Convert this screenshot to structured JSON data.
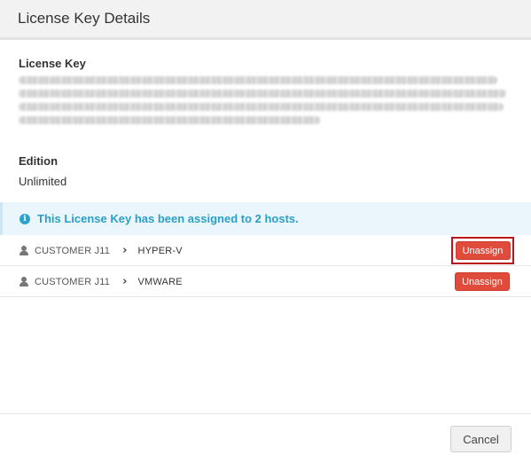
{
  "modal": {
    "title": "License Key Details"
  },
  "license_key": {
    "label": "License Key"
  },
  "edition": {
    "label": "Edition",
    "value": "Unlimited"
  },
  "alert": {
    "icon": "info-icon",
    "text": "This License Key has been assigned to 2 hosts.",
    "color": "#2a9fc9"
  },
  "hosts": [
    {
      "customer": "CUSTOMER J11",
      "host": "HYPER-V",
      "action_label": "Unassign"
    },
    {
      "customer": "CUSTOMER J11",
      "host": "VMWARE",
      "action_label": "Unassign"
    }
  ],
  "footer": {
    "cancel_label": "Cancel"
  },
  "colors": {
    "danger": "#e04b3c",
    "highlight": "#c0121b"
  }
}
